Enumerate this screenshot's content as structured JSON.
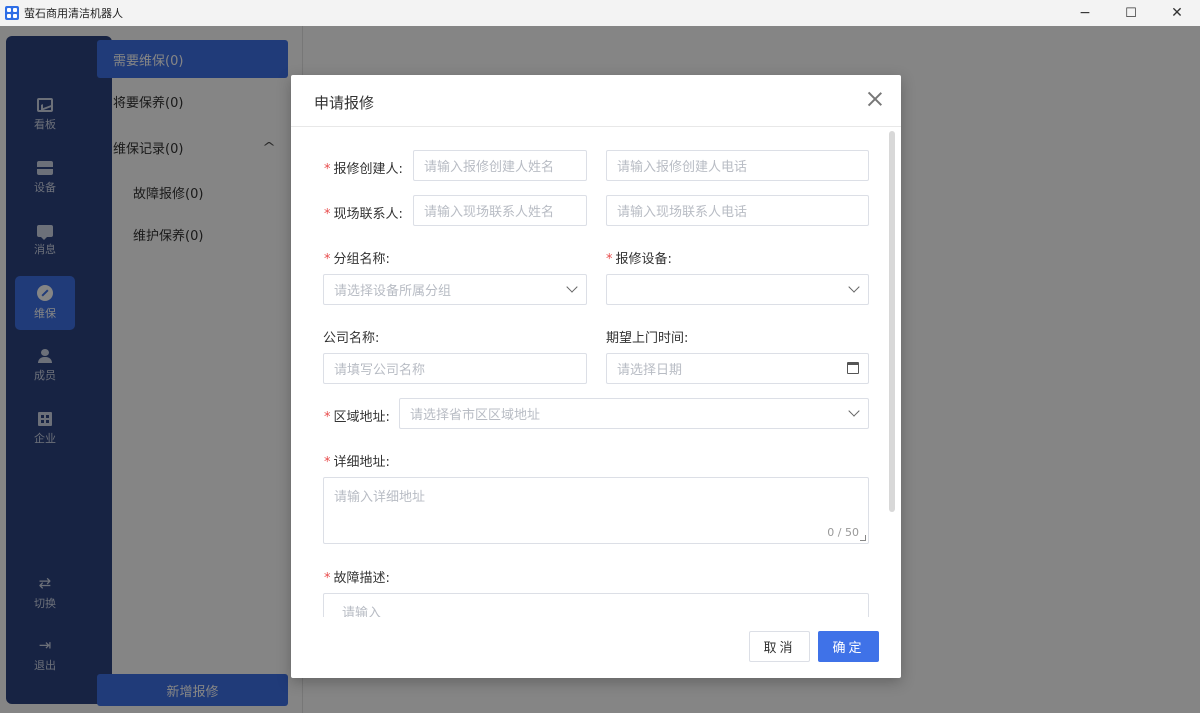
{
  "window": {
    "title": "萤石商用清洁机器人",
    "minimize": "−",
    "maximize": "☐",
    "close": "✕"
  },
  "sidebar": {
    "items": [
      {
        "label": "看板",
        "icon": "dashboard-icon"
      },
      {
        "label": "设备",
        "icon": "device-icon"
      },
      {
        "label": "消息",
        "icon": "message-icon"
      },
      {
        "label": "维保",
        "icon": "maintenance-icon",
        "active": true
      },
      {
        "label": "成员",
        "icon": "member-icon"
      },
      {
        "label": "企业",
        "icon": "enterprise-icon"
      }
    ],
    "switch": {
      "label": "切换",
      "glyph": "⇄"
    },
    "logout": {
      "label": "退出",
      "glyph": "⇥"
    }
  },
  "subnav": {
    "needs_maintenance": "需要维保(0)",
    "upcoming_maintenance": "将要保养(0)",
    "records": "维保记录(0)",
    "fault_repair": "故障报修(0)",
    "maintenance_care": "维护保养(0)",
    "collapse_glyph": "^",
    "new_repair_button": "新增报修"
  },
  "dialog": {
    "title": "申请报修",
    "fields": {
      "creator_label": "报修创建人:",
      "creator_name_placeholder": "请输入报修创建人姓名",
      "creator_phone_placeholder": "请输入报修创建人电话",
      "contact_label": "现场联系人:",
      "contact_name_placeholder": "请输入现场联系人姓名",
      "contact_phone_placeholder": "请输入现场联系人电话",
      "group_label": "分组名称:",
      "group_placeholder": "请选择设备所属分组",
      "device_label": "报修设备:",
      "device_value": "",
      "company_label": "公司名称:",
      "company_placeholder": "请填写公司名称",
      "visit_time_label": "期望上门时间:",
      "visit_time_placeholder": "请选择日期",
      "region_label": "区域地址:",
      "region_placeholder": "请选择省市区区域地址",
      "address_label": "详细地址:",
      "address_placeholder": "请输入详细地址",
      "address_counter": "0 / 50",
      "fault_label": "故障描述:",
      "fault_placeholder": "请输入"
    },
    "required_mark": "*",
    "cancel_label": "取消",
    "ok_label": "确定"
  }
}
